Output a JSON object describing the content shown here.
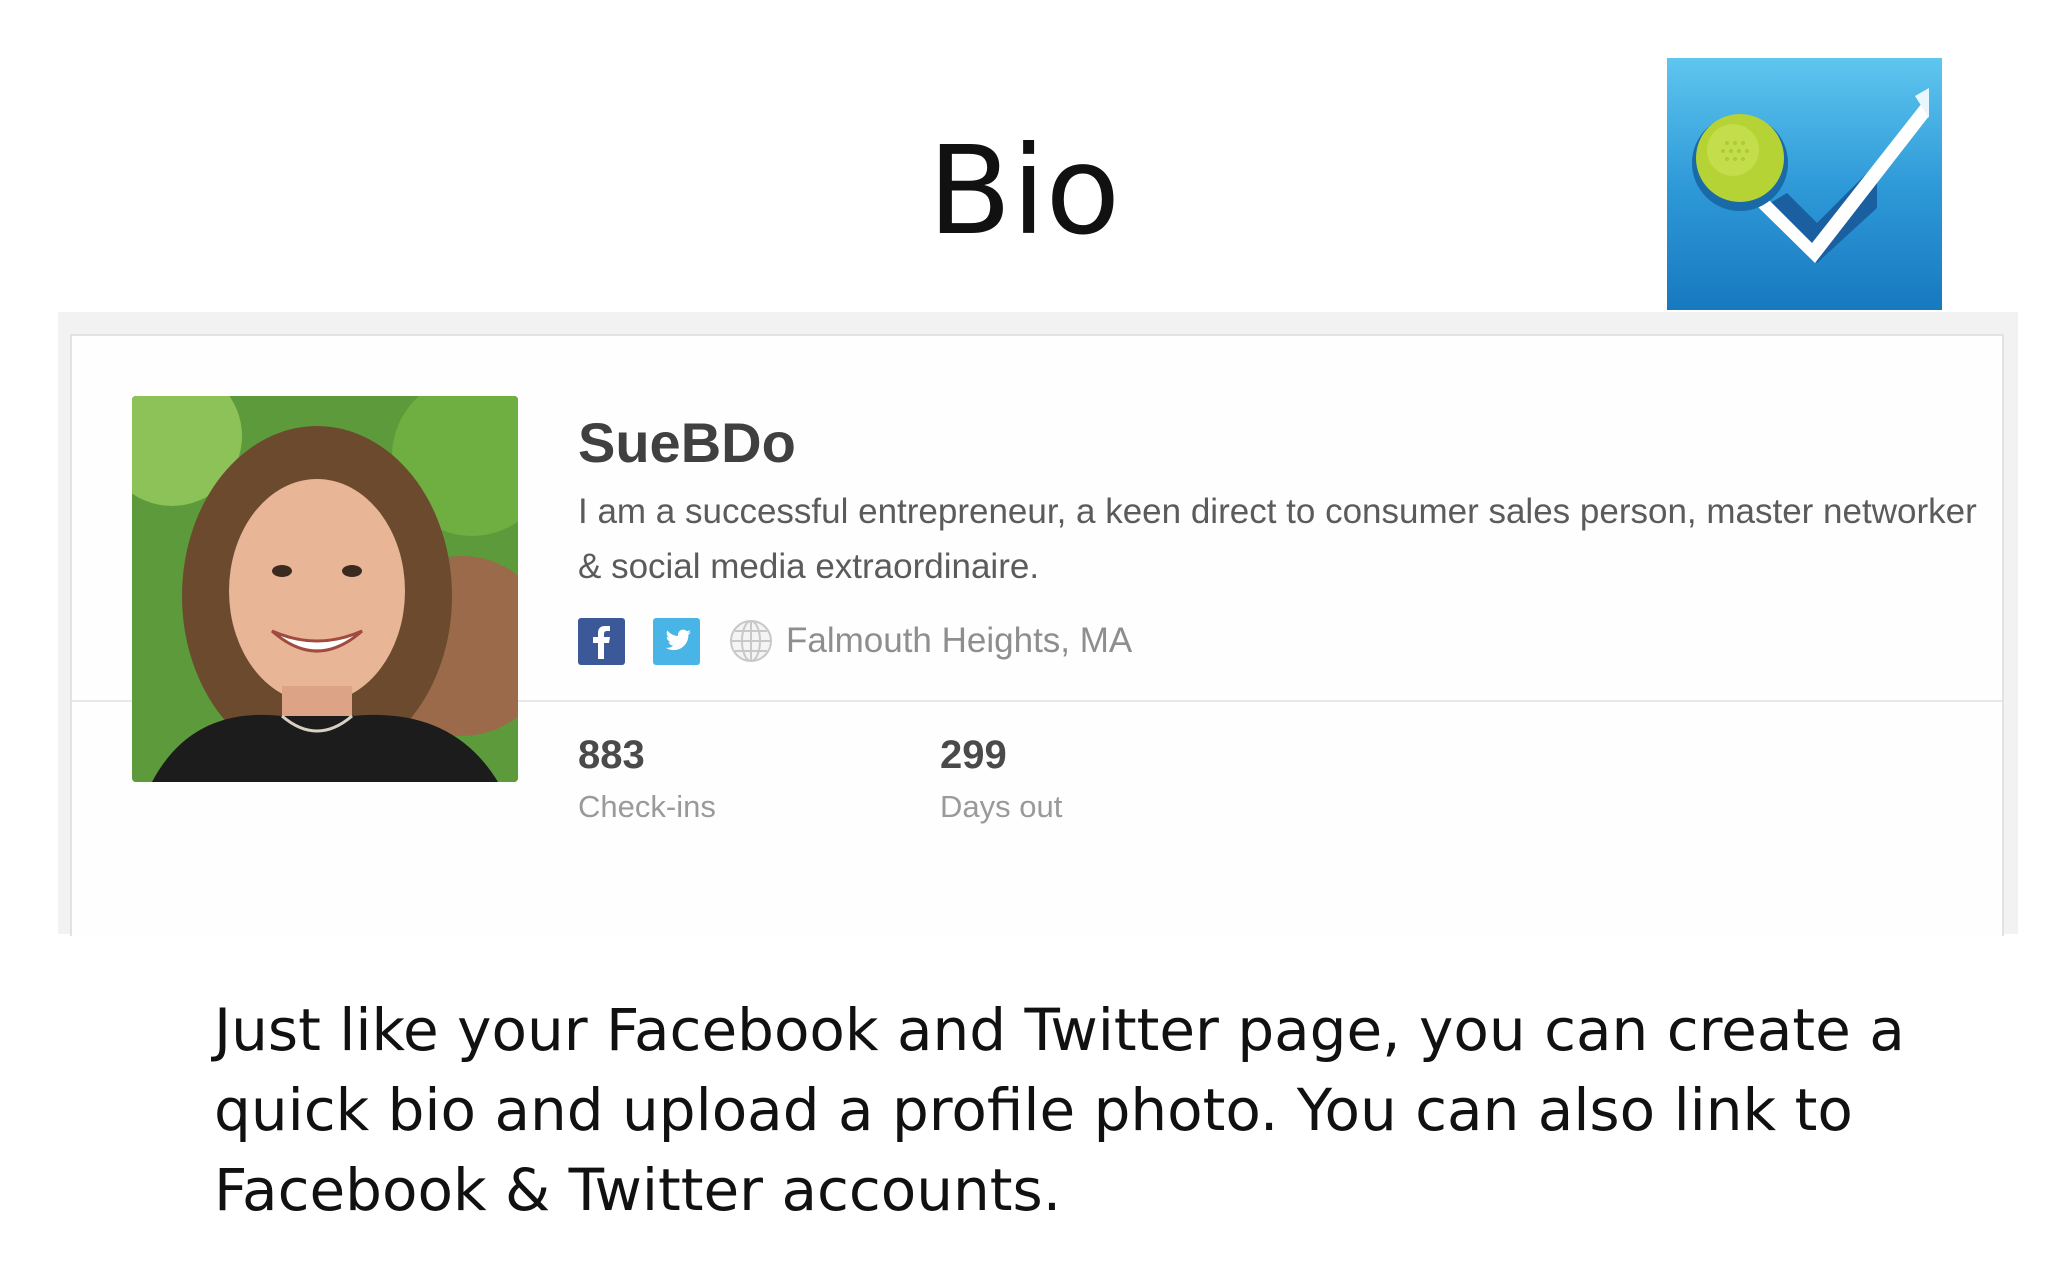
{
  "slide": {
    "title": "Bio",
    "caption": "Just like your Facebook and Twitter page, you can create a quick bio and upload a profile photo.  You can also link to Facebook & Twitter accounts."
  },
  "logo": {
    "icon": "foursquare-check-icon",
    "colors": {
      "bg_top": "#5fc6ef",
      "bg_bottom": "#1779c0",
      "ball": "#b5d334"
    }
  },
  "profile": {
    "username": "SueBDo",
    "bio": "I am a successful entrepreneur, a keen direct to consumer sales person, master networker & social media extraordinaire.",
    "location": "Falmouth Heights, MA",
    "social": [
      {
        "name": "facebook",
        "icon": "facebook-icon",
        "color": "#3b5998"
      },
      {
        "name": "twitter",
        "icon": "twitter-icon",
        "color": "#49b5e6"
      }
    ],
    "location_icon": "globe-icon",
    "stats": [
      {
        "value": "883",
        "label": "Check-ins"
      },
      {
        "value": "299",
        "label": "Days out"
      }
    ]
  }
}
